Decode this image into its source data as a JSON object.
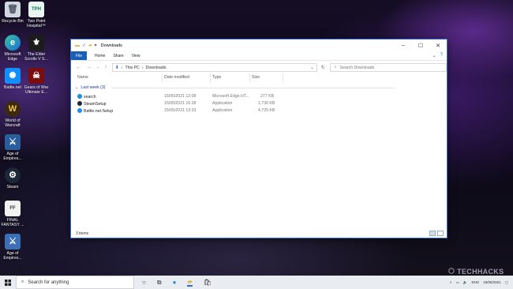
{
  "desktop": {
    "icons": [
      {
        "label": "Recycle Bin"
      },
      {
        "label": "Two Point Hospital™"
      },
      {
        "label": "Microsoft Edge"
      },
      {
        "label": "The Elder Scrolls V S..."
      },
      {
        "label": "Battle.net"
      },
      {
        "label": "Gears of War Ultimate E..."
      },
      {
        "label": "World of Warcraft"
      },
      {
        "label": "Age of Empires..."
      },
      {
        "label": "Steam"
      },
      {
        "label": "FINAL FANTASY ..."
      },
      {
        "label": "Age of Empires..."
      }
    ],
    "watermark": "TECHHACKS"
  },
  "explorer": {
    "title": "Downloads",
    "ribbon": {
      "file": "File",
      "tabs": [
        "Home",
        "Share",
        "View"
      ]
    },
    "address": {
      "root": "This PC",
      "folder": "Downloads"
    },
    "search_placeholder": "Search Downloads",
    "columns": [
      "Name",
      "Date modified",
      "Type",
      "Size"
    ],
    "group": "Last week (3)",
    "files": [
      {
        "name": "search",
        "date": "15/05/2021 12:08",
        "type": "Microsoft Edge HT...",
        "size": "277 KB",
        "icon_color": "#1b8fe0"
      },
      {
        "name": "SteamSetup",
        "date": "15/05/2021 16:28",
        "type": "Application",
        "size": "1,730 KB",
        "icon_color": "#1b2838"
      },
      {
        "name": "Battle.net-Setup",
        "date": "15/05/2021 13:33",
        "type": "Application",
        "size": "4,725 KB",
        "icon_color": "#148eff"
      }
    ],
    "status": "3 items"
  },
  "taskbar": {
    "search_placeholder": "Search for anything",
    "lang": "ENG",
    "date": "19/05/2021"
  }
}
